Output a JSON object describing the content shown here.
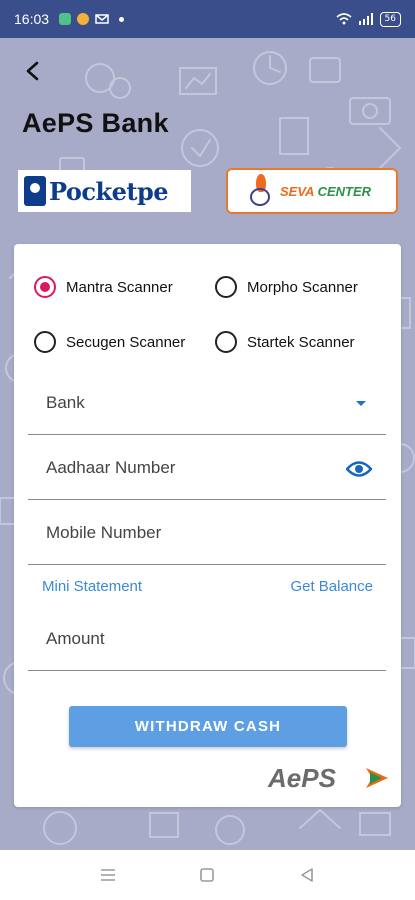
{
  "status_bar": {
    "time": "16:03",
    "battery": "56",
    "icons": [
      "app-icon",
      "app-icon",
      "mail-icon",
      "wifi-icon",
      "signal-icon",
      "battery-icon"
    ]
  },
  "header": {
    "title": "AePS Bank",
    "back_icon": "arrow-left-icon"
  },
  "brands": {
    "left_logo": "Pocketpe",
    "right_logo_part1": "SEVA",
    "right_logo_part2": "CENTER",
    "footer_logo": "AePS"
  },
  "scanners": [
    {
      "label": "Mantra Scanner",
      "selected": true
    },
    {
      "label": "Morpho Scanner",
      "selected": false
    },
    {
      "label": "Secugen Scanner",
      "selected": false
    },
    {
      "label": "Startek Scanner",
      "selected": false
    }
  ],
  "form": {
    "bank_label": "Bank",
    "aadhaar_label": "Aadhaar Number",
    "mobile_label": "Mobile Number",
    "amount_label": "Amount"
  },
  "links": {
    "mini_statement": "Mini Statement",
    "get_balance": "Get Balance"
  },
  "actions": {
    "withdraw": "WITHDRAW CASH"
  },
  "colors": {
    "status_bar": "#3a4e8c",
    "background": "#a7abc8",
    "accent": "#5e9fe3",
    "radio_selected": "#d81b60",
    "link": "#3a8ad6"
  },
  "nav": {
    "icons": [
      "menu-icon",
      "home-square-icon",
      "back-triangle-icon"
    ]
  }
}
